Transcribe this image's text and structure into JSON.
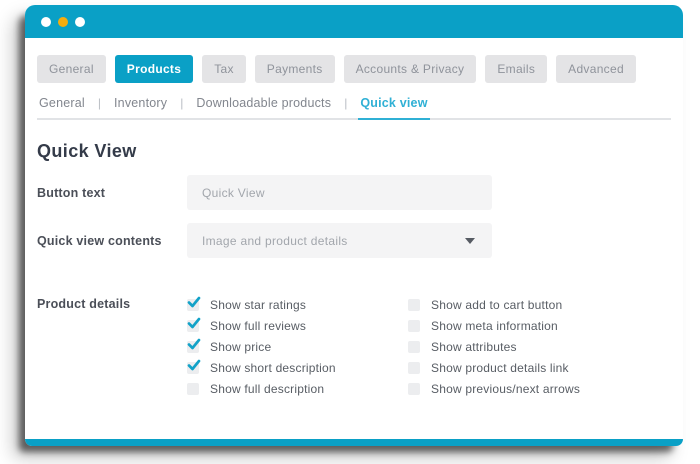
{
  "colors": {
    "teal_primary": "#0aa0c6",
    "teal_light": "#2fb0d5",
    "dot_white": "#ffffff",
    "dot_yellow": "#f5ad0e"
  },
  "titlebar": {
    "dots": [
      {
        "color": "#ffffff"
      },
      {
        "color": "#f5ad0e"
      },
      {
        "color": "#ffffff"
      }
    ]
  },
  "tabs": [
    {
      "label": "General",
      "active": false
    },
    {
      "label": "Products",
      "active": true
    },
    {
      "label": "Tax",
      "active": false
    },
    {
      "label": "Payments",
      "active": false
    },
    {
      "label": "Accounts & Privacy",
      "active": false
    },
    {
      "label": "Emails",
      "active": false
    },
    {
      "label": "Advanced",
      "active": false
    }
  ],
  "subtab_separator": "|",
  "subtabs": [
    {
      "label": "General",
      "active": false
    },
    {
      "label": "Inventory",
      "active": false
    },
    {
      "label": "Downloadable products",
      "active": false
    },
    {
      "label": "Quick view",
      "active": true
    }
  ],
  "page": {
    "heading": "Quick View"
  },
  "form": {
    "button_text": {
      "label": "Button text",
      "value": "",
      "placeholder": "Quick View"
    },
    "quick_view_contents": {
      "label": "Quick view contents",
      "selected": "Image and product details"
    },
    "product_details": {
      "label": "Product details",
      "left": [
        {
          "label": "Show star ratings",
          "checked": true
        },
        {
          "label": "Show full reviews",
          "checked": true
        },
        {
          "label": "Show price",
          "checked": true
        },
        {
          "label": "Show short description",
          "checked": true
        },
        {
          "label": "Show full description",
          "checked": false
        }
      ],
      "right": [
        {
          "label": "Show add to cart button",
          "checked": false
        },
        {
          "label": "Show meta information",
          "checked": false
        },
        {
          "label": "Show attributes",
          "checked": false
        },
        {
          "label": "Show product details link",
          "checked": false
        },
        {
          "label": "Show previous/next arrows",
          "checked": false
        }
      ]
    }
  }
}
